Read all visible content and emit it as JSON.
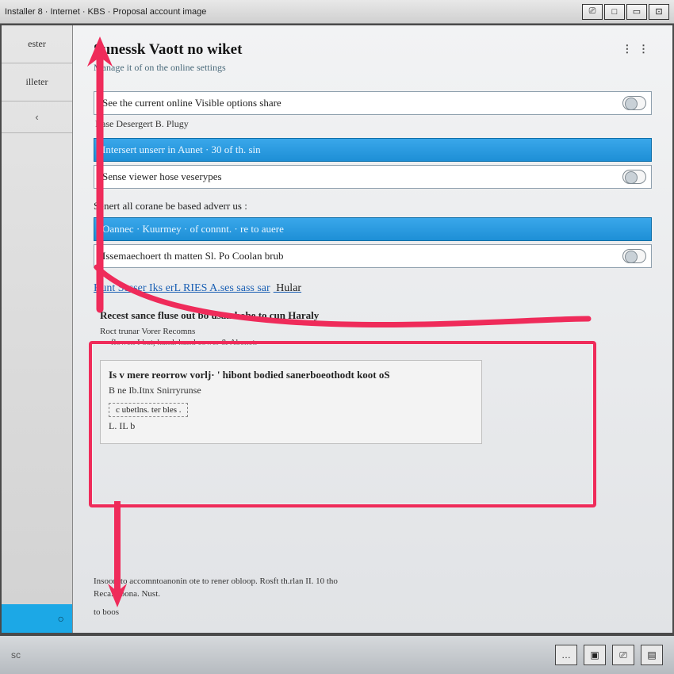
{
  "titlebar": {
    "text": "Installer 8 · Internet · KBS · Proposal account image"
  },
  "window_controls": {
    "a": "⎚",
    "b": "□",
    "c": "▭",
    "d": "⊡"
  },
  "sidebar": {
    "items": [
      "ester",
      "illeter"
    ],
    "toggle_glyph": "‹",
    "accent_glyph": "○"
  },
  "page": {
    "title": "Sunessk Vaott no wiket",
    "subtitle": "Manage it of on the online settings",
    "more_glyph": "⋮ ⋮"
  },
  "rows": {
    "r1": "See the current online Visible options share",
    "c1": "Base Desergert B. Plugy",
    "r2": "Intersert unserr in Aunet · 30 of th. sin",
    "r3": "Sense viewer hose veserypes",
    "sect2": "Senert all corane be based adverr us :",
    "r4": "Oannec · Kuurmey · of connnt. · re to auere",
    "r5": "Issemaechoert th matten          Sl. Po Coolan brub",
    "r5b": ""
  },
  "link": {
    "text": "Runt Sesser Iks erL RIES  A.ses sass sar",
    "suffix": "  Hular"
  },
  "block": {
    "head": "Recest sance fluse out bo usan hobe to cun Haraly",
    "s1": "Roct trunar Vorer Recomns",
    "s2": "—  flowen I bat, hand. hand cower & Abenet."
  },
  "card": {
    "bold": "Is v mere reorrow vorlj· '   hibont bodied sanerboeothodt koot  oS",
    "line": "B ne Ib.Itnx Snirryrunse",
    "dash": "c  ubetlns. ter bles .",
    "foot": "  L. IL   b"
  },
  "trail": {
    "t1": "Insoort to accomntoanonin ote to rener obloop.      Rosft th.rlan II. 10 tho",
    "t2": "Reca.  Soona.  Nust.",
    "t3": "to boos"
  },
  "taskbar": {
    "left": "sc",
    "i1": "…",
    "i2": "▣",
    "i3": "⎚",
    "i4": "▤"
  },
  "colors": {
    "accent": "#1e8fd6",
    "highlight": "#ef2b5a"
  }
}
